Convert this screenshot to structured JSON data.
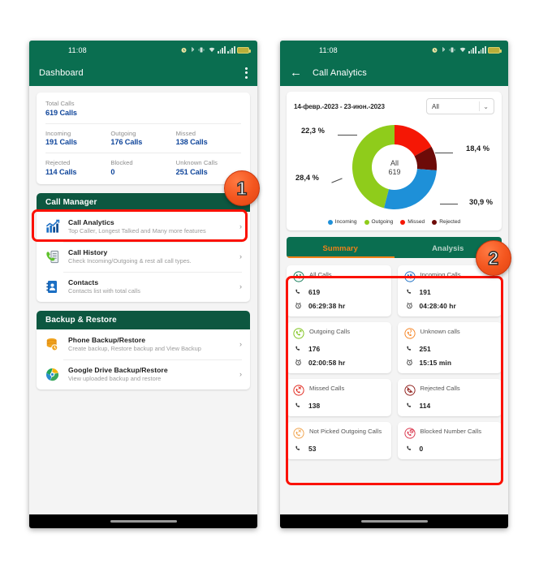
{
  "status_bar": {
    "time": "11:08",
    "icons": [
      "alarm-icon",
      "bluetooth-icon",
      "vibrate-icon",
      "wifi-icon",
      "signal-1-icon",
      "signal-2-icon",
      "battery-icon"
    ]
  },
  "left_phone": {
    "appbar": {
      "title": "Dashboard",
      "menu_icon": "kebab-menu-icon"
    },
    "totals": {
      "total": {
        "label": "Total Calls",
        "value": "619 Calls"
      },
      "row1": [
        {
          "label": "Incoming",
          "value": "191 Calls"
        },
        {
          "label": "Outgoing",
          "value": "176 Calls"
        },
        {
          "label": "Missed",
          "value": "138 Calls"
        }
      ],
      "row2": [
        {
          "label": "Rejected",
          "value": "114 Calls"
        },
        {
          "label": "Blocked",
          "value": "0"
        },
        {
          "label": "Unknown Calls",
          "value": "251 Calls"
        }
      ]
    },
    "sections": [
      {
        "title": "Call Manager",
        "items": [
          {
            "icon": "bar-chart-icon",
            "title": "Call Analytics",
            "subtitle": "Top Caller, Longest Talked and Many more features"
          },
          {
            "icon": "call-history-icon",
            "title": "Call History",
            "subtitle": "Check Incoming/Outgoing & rest all call types."
          },
          {
            "icon": "contacts-icon",
            "title": "Contacts",
            "subtitle": "Contacts list with total calls"
          }
        ]
      },
      {
        "title": "Backup & Restore",
        "items": [
          {
            "icon": "database-backup-icon",
            "title": "Phone Backup/Restore",
            "subtitle": "Create backup, Restore backup and View Backup"
          },
          {
            "icon": "google-drive-icon",
            "title": "Google Drive Backup/Restore",
            "subtitle": "View uploaded backup and restore"
          }
        ]
      }
    ]
  },
  "right_phone": {
    "appbar": {
      "back_icon": "back-arrow-icon",
      "title": "Call Analytics"
    },
    "date_range": "14-февр.-2023 - 23-июн.-2023",
    "filter": {
      "value": "All",
      "chevron": "chevron-down-icon"
    },
    "tabs": [
      {
        "label": "Summary",
        "active": true
      },
      {
        "label": "Analysis",
        "active": false
      }
    ],
    "stat_cards": [
      {
        "icon": "all-calls-icon",
        "title": "All Calls",
        "count": "619",
        "duration": "06:29:38 hr"
      },
      {
        "icon": "incoming-call-icon",
        "title": "Incoming Calls",
        "count": "191",
        "duration": "04:28:40 hr"
      },
      {
        "icon": "outgoing-call-icon",
        "title": "Outgoing Calls",
        "count": "176",
        "duration": "02:00:58 hr"
      },
      {
        "icon": "unknown-call-icon",
        "title": "Unknown calls",
        "count": "251",
        "duration": "15:15 min"
      },
      {
        "icon": "missed-call-icon",
        "title": "Missed Calls",
        "count": "138",
        "duration": ""
      },
      {
        "icon": "rejected-call-icon",
        "title": "Rejected Calls",
        "count": "114",
        "duration": ""
      },
      {
        "icon": "not-picked-call-icon",
        "title": "Not Picked Outgoing Calls",
        "count": "53",
        "duration": ""
      },
      {
        "icon": "blocked-call-icon",
        "title": "Blocked Number Calls",
        "count": "0",
        "duration": ""
      }
    ]
  },
  "annotations": [
    {
      "number": "1",
      "target": "call-analytics-row"
    },
    {
      "number": "2",
      "target": "summary-cards-grid"
    }
  ],
  "colors": {
    "header_green": "#0a6e50",
    "section_green": "#0d5740",
    "value_blue": "#10469b",
    "tab_orange": "#f08019",
    "highlight_red": "#fb1102",
    "incoming": "#1e90d8",
    "outgoing": "#8fcc1b",
    "missed": "#f51705",
    "rejected": "#6d0b08"
  },
  "chart_data": {
    "type": "pie",
    "title": "All",
    "center_label": "All",
    "center_value": "619",
    "categories": [
      "Incoming",
      "Outgoing",
      "Missed",
      "Rejected"
    ],
    "values": [
      191,
      176,
      138,
      114
    ],
    "percent_labels": [
      "30,9 %",
      "28,4 %",
      "22,3 %",
      "18,4 %"
    ],
    "colors": [
      "#1e90d8",
      "#8fcc1b",
      "#f51705",
      "#6d0b08"
    ],
    "legend": [
      "Incoming",
      "Outgoing",
      "Missed",
      "Rejected"
    ],
    "legend_position": "bottom",
    "grid": false
  }
}
